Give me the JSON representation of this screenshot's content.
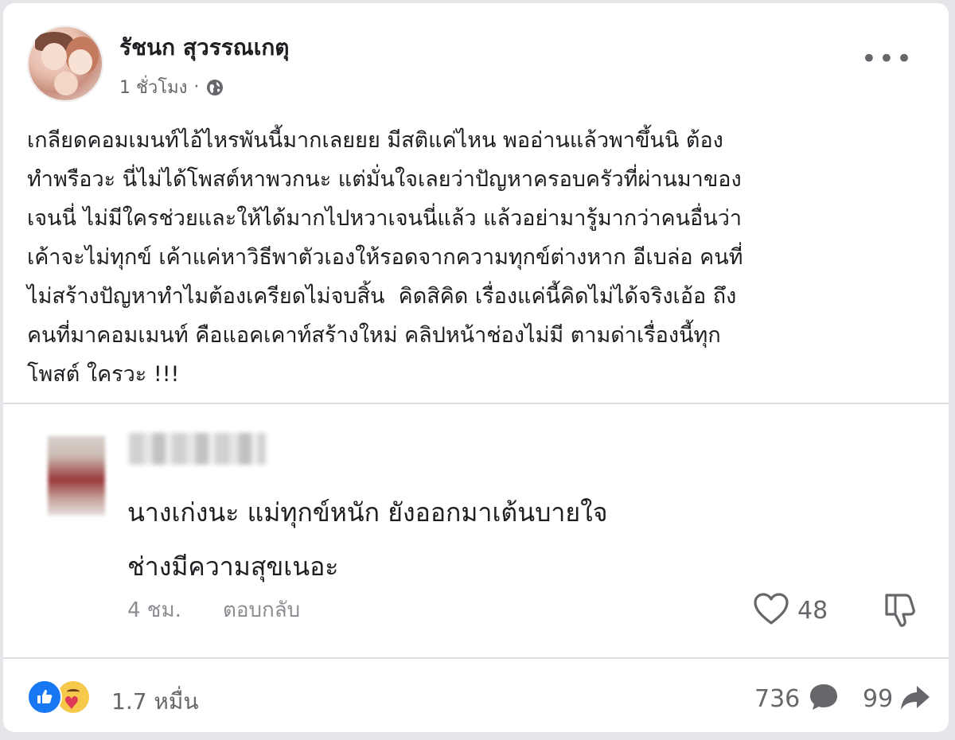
{
  "post": {
    "author_name": "รัชนก สุวรรณเกตุ",
    "timestamp": "1 ชั่วโมง",
    "separator": "·",
    "audience_icon": "globe-icon",
    "more_icon": "more-dots-icon",
    "more_label": "•••",
    "text": "เกลียดคอมเมนท์ไอ้ไหรพันนี้มากเลยยย มีสติแค่ไหน พออ่านแล้วพาขึ้นนิ ต้อง\nทำพรือวะ นี่ไม่ได้โพสต์หาพวกนะ แต่มั่นใจเลยว่าปัญหาครอบครัวที่ผ่านมาของ\nเจนนี่ ไม่มีใครช่วยและให้ได้มากไปหวาเจนนี่แล้ว แล้วอย่ามารู้มากว่าคนอื่นว่า\nเค้าจะไม่ทุกข์ เค้าแค่หาวิธีพาตัวเองให้รอดจากความทุกข์ต่างหาก อีเบล่อ คนที่\nไม่สร้างปัญหาทำไมต้องเครียดไม่จบสิ้น  คิดสิคิด เรื่องแค่นี้คิดไม่ได้จริงเอ้อ ถึง\nคนที่มาคอมเมนท์ คือแอคเคาท์สร้างใหม่ คลิปหน้าช่องไม่มี ตามด่าเรื่องนี้ทุก\nโพสต์ ใครวะ !!!"
  },
  "comment": {
    "text": "นางเก่งนะ แม่ทุกข์หนัก ยังออกมาเต้นบายใจ\nช่างมีความสุขเนอะ",
    "time": "4 ชม.",
    "reply_label": "ตอบกลับ",
    "like_count": "48",
    "like_icon": "heart-outline-icon",
    "dislike_icon": "thumbs-down-icon"
  },
  "footer": {
    "reaction_count": "1.7 หมื่น",
    "reaction_icons": [
      "like-icon",
      "care-icon"
    ],
    "comment_count": "736",
    "comment_icon": "comment-bubble-icon",
    "share_count": "99",
    "share_icon": "share-arrow-icon"
  },
  "colors": {
    "like_blue": "#1877f2",
    "text_primary": "#1c1e21",
    "text_secondary": "#65676b"
  }
}
